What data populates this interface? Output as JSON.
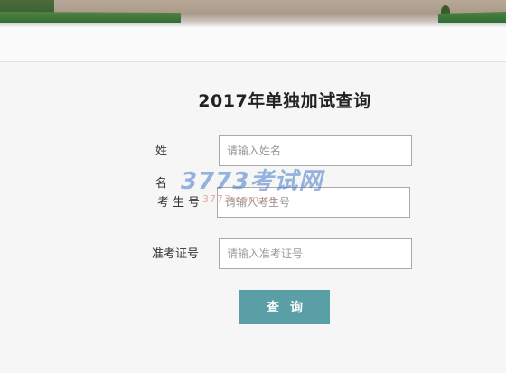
{
  "form": {
    "title": "2017年单独加试查询",
    "fields": [
      {
        "label": "姓 名",
        "placeholder": "请输入姓名",
        "value": ""
      },
      {
        "label": "考生号",
        "placeholder": "请输入考生号",
        "value": ""
      },
      {
        "label": "准考证号",
        "placeholder": "请输入准考证号",
        "value": ""
      }
    ],
    "submit_label": "查询"
  },
  "watermark": {
    "text": "3773考试网",
    "sub_text": "3773.com.cn"
  },
  "colors": {
    "button": "#5a9fa6",
    "background": "#f6f6f6",
    "input_border": "#a9a9a9"
  }
}
